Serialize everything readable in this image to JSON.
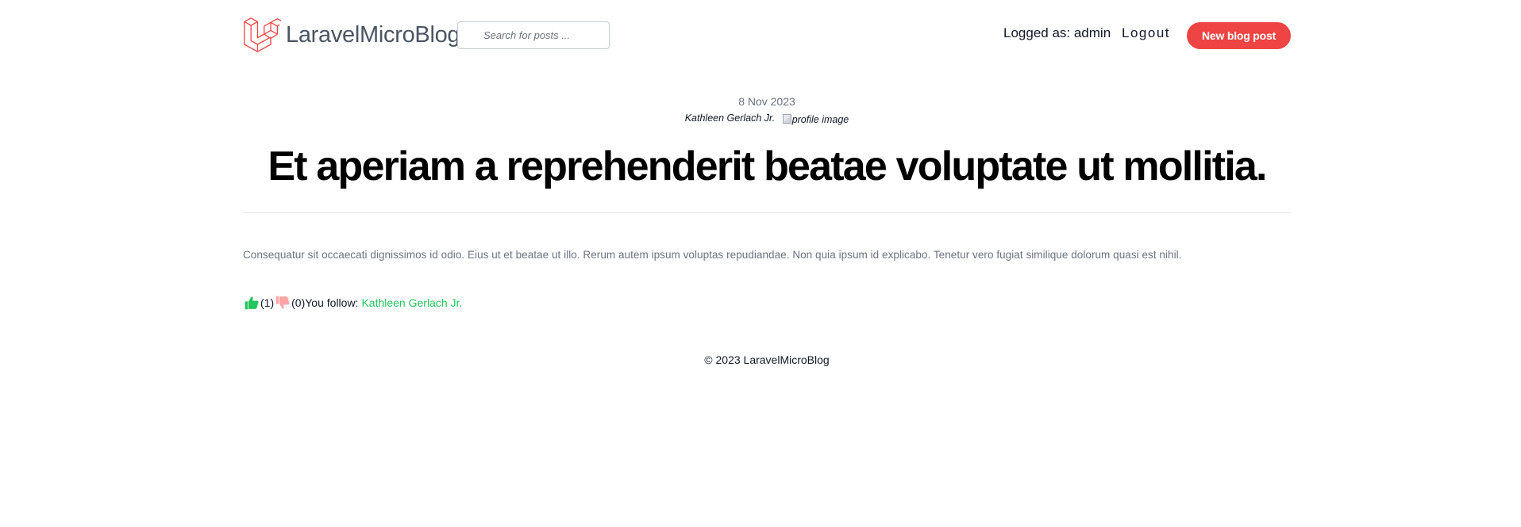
{
  "header": {
    "brand": "LaravelMicroBlog",
    "search_placeholder": "Search for posts ...",
    "logged_as": "Logged as: admin",
    "logout_label": "Logout",
    "new_post_label": "New blog post",
    "accent_color": "#ef4444"
  },
  "post": {
    "date": "8 Nov 2023",
    "author": "Kathleen Gerlach Jr.",
    "profile_image_alt": "profile image",
    "title": "Et aperiam a reprehenderit beatae voluptate ut mollitia.",
    "body": "Consequatur sit occaecati dignissimos id odio. Eius ut et beatae ut illo. Rerum autem ipsum voluptas repudiandae. Non quia ipsum id explicabo. Tenetur vero fugiat similique dolorum quasi est nihil."
  },
  "reactions": {
    "like_icon": "thumbs-up-icon",
    "like_count": "(1)",
    "dislike_icon": "thumbs-down-icon",
    "dislike_count": "(0)",
    "follow_label": "You follow:",
    "follow_name": "Kathleen Gerlach Jr.",
    "like_color": "#22c55e",
    "dislike_color": "#fca5a5",
    "follow_color": "#22c55e"
  },
  "footer": {
    "copyright": "© 2023 LaravelMicroBlog"
  }
}
